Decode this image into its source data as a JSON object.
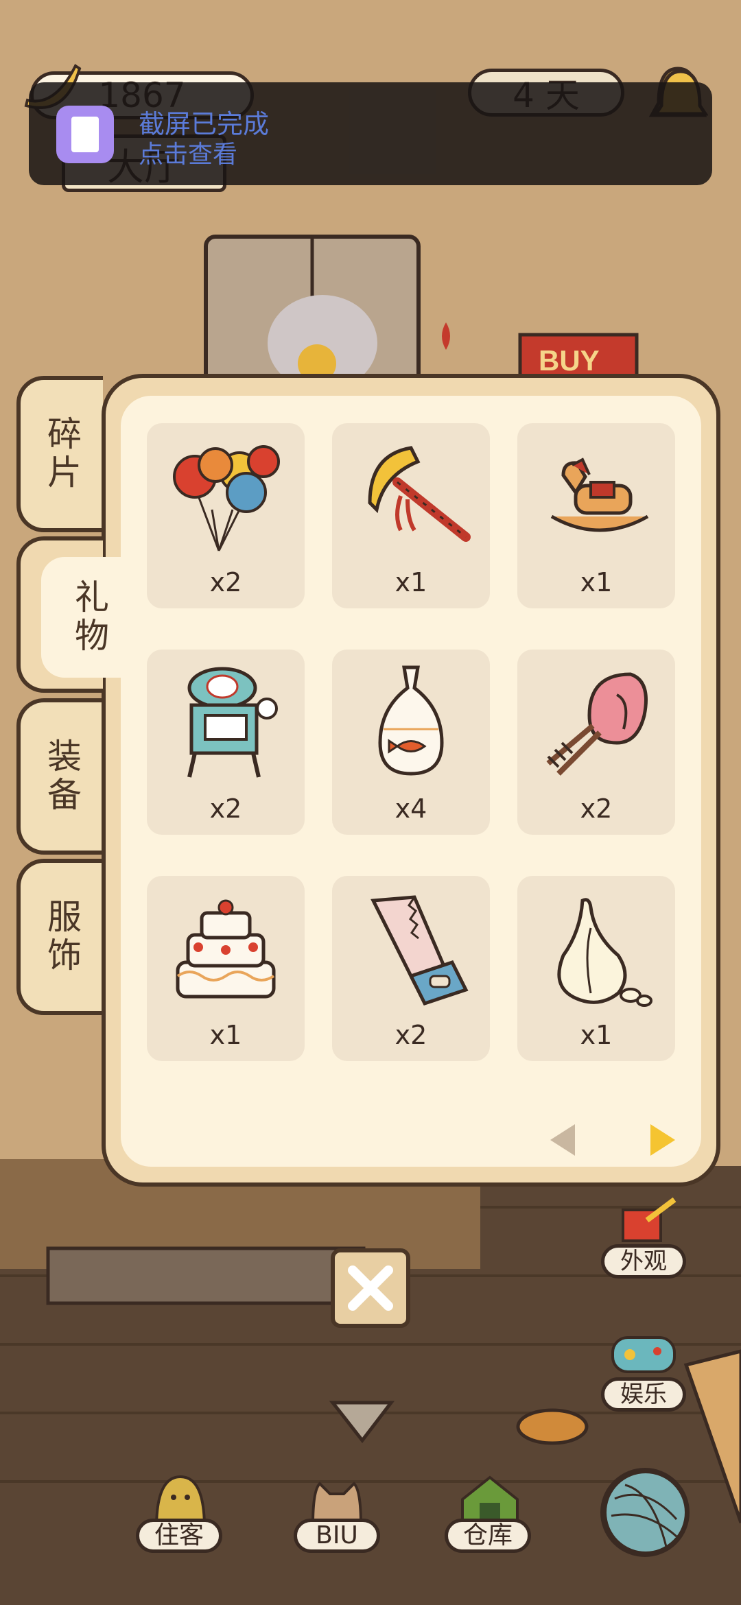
{
  "hud": {
    "coins": "1867",
    "days": "4 天",
    "room_name": "大厅"
  },
  "notification": {
    "title": "截屏已完成",
    "subtitle": "点击查看"
  },
  "scene": {
    "buy_sign": "BUY"
  },
  "tabs": [
    {
      "label": "碎片",
      "active": false
    },
    {
      "label": "礼物",
      "active": true
    },
    {
      "label": "装备",
      "active": false
    },
    {
      "label": "服饰",
      "active": false
    }
  ],
  "items": [
    {
      "name": "balloons",
      "count": "x2"
    },
    {
      "name": "trumpet",
      "count": "x1"
    },
    {
      "name": "rocking-horse",
      "count": "x1"
    },
    {
      "name": "shaved-ice-machine",
      "count": "x2"
    },
    {
      "name": "goldfish-bag",
      "count": "x4"
    },
    {
      "name": "hand-mixer",
      "count": "x2"
    },
    {
      "name": "cake",
      "count": "x1"
    },
    {
      "name": "saw",
      "count": "x2"
    },
    {
      "name": "garlic",
      "count": "x1"
    }
  ],
  "side_buttons": {
    "appearance": "外观",
    "entertainment": "娱乐"
  },
  "bottom_nav": {
    "residents": "住客",
    "biu": "BIU",
    "warehouse": "仓库"
  },
  "colors": {
    "panel": "#f0d9b0",
    "panel_inner": "#fdf3dd",
    "outline": "#4a3626",
    "item_bg": "#f0e3ce",
    "arrow_active": "#f5c431",
    "arrow_inactive": "#c9b7a0",
    "notification_text": "#5b7bd8"
  }
}
